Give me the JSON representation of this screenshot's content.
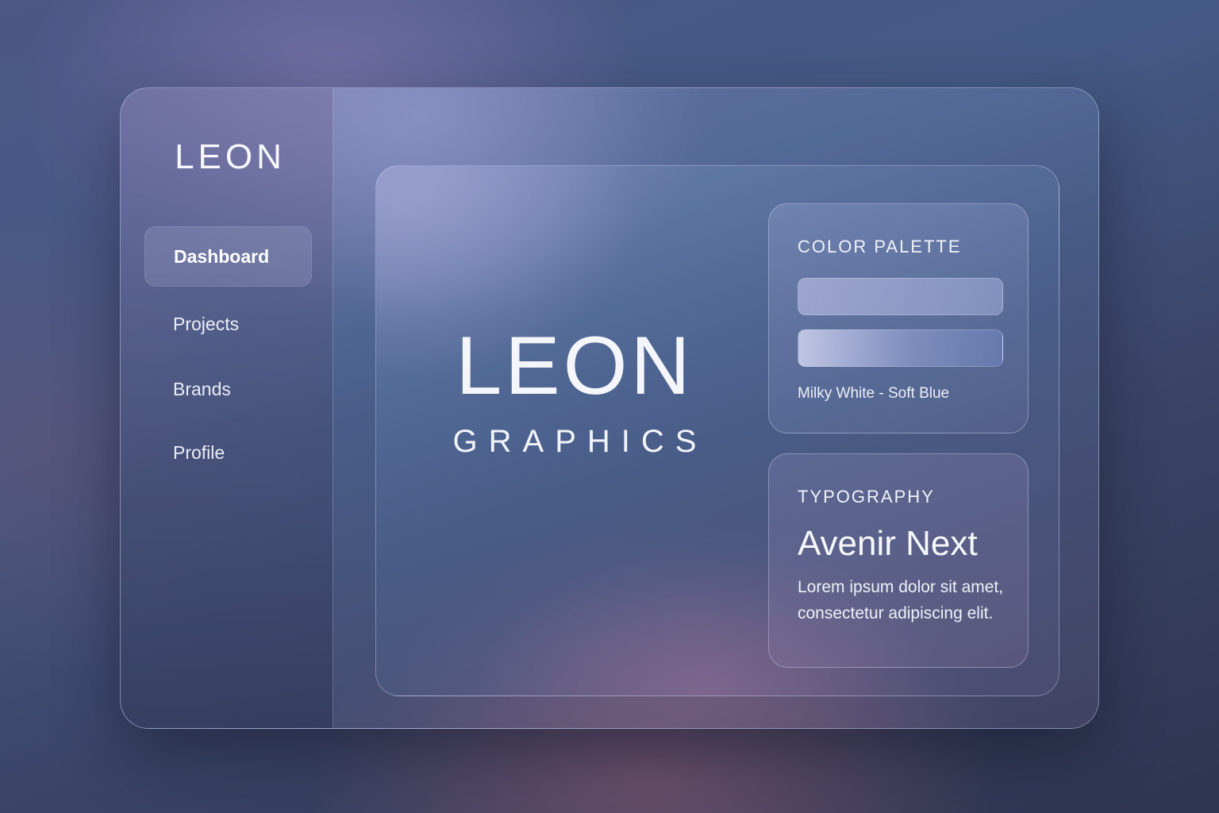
{
  "sidebar": {
    "logo": "LEON",
    "items": [
      {
        "label": "Dashboard",
        "active": true
      },
      {
        "label": "Projects",
        "active": false
      },
      {
        "label": "Brands",
        "active": false
      },
      {
        "label": "Profile",
        "active": false
      }
    ]
  },
  "main": {
    "brand_title": "LEON",
    "brand_subtitle": "GRAPHICS",
    "color_palette": {
      "title": "COLOR PALETTE",
      "swatches": [
        "#aab3dc",
        "#cfd2ee"
      ],
      "caption": "Milky White - Soft Blue"
    },
    "typography": {
      "title": "TYPOGRAPHY",
      "font_name": "Avenir Next",
      "sample_text": "Lorem ipsum dolor sit amet, consectetur adipiscing elit."
    }
  }
}
